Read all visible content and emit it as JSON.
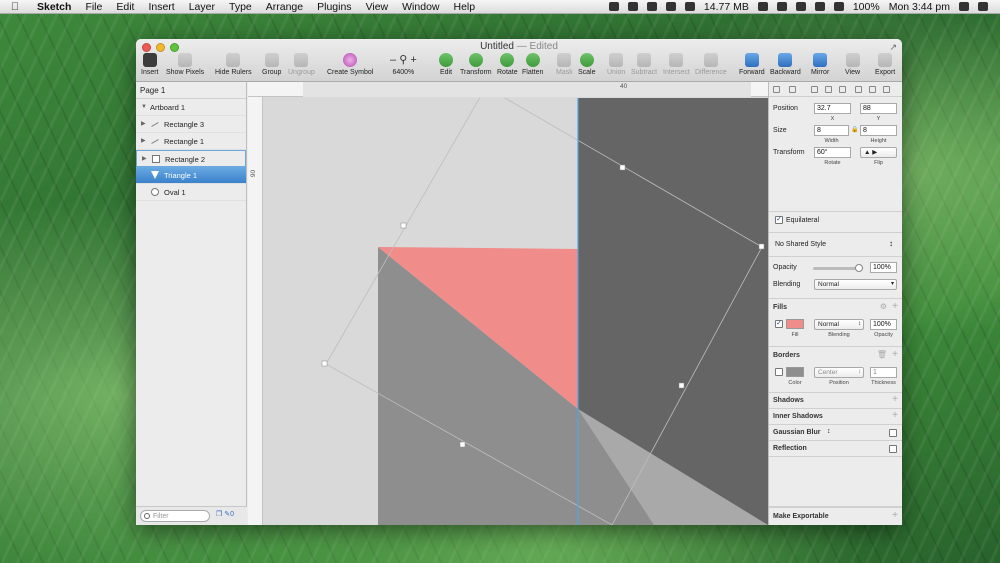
{
  "menubar": {
    "app": "Sketch",
    "items": [
      "File",
      "Edit",
      "Insert",
      "Layer",
      "Type",
      "Arrange",
      "Plugins",
      "View",
      "Window",
      "Help"
    ],
    "memory": "14.77 MB",
    "battery": "100%",
    "clock": "Mon 3:44 pm"
  },
  "window": {
    "title": "Untitled",
    "edited": "— Edited"
  },
  "toolbar": {
    "insert": "Insert",
    "show_pixels": "Show Pixels",
    "hide_rulers": "Hide Rulers",
    "group": "Group",
    "ungroup": "Ungroup",
    "create_symbol": "Create Symbol",
    "zoom": "6400%",
    "edit": "Edit",
    "transform": "Transform",
    "rotate": "Rotate",
    "flatten": "Flatten",
    "mask": "Mask",
    "scale": "Scale",
    "union": "Union",
    "subtract": "Subtract",
    "intersect": "Intersect",
    "difference": "Difference",
    "forward": "Forward",
    "backward": "Backward",
    "mirror": "Mirror",
    "view": "View",
    "export": "Export"
  },
  "layers": {
    "page": "Page 1",
    "artboard": "Artboard 1",
    "items": [
      {
        "name": "Rectangle 3",
        "icon": "line-icon"
      },
      {
        "name": "Rectangle 1",
        "icon": "line-icon"
      },
      {
        "name": "Rectangle 2",
        "icon": "rectangle-icon"
      },
      {
        "name": "Triangle 1",
        "icon": "triangle-icon"
      },
      {
        "name": "Oval 1",
        "icon": "oval-icon"
      }
    ],
    "filter_placeholder": "Filter",
    "filter_count": "0"
  },
  "rulers": {
    "h_label": "40",
    "v_label": "90"
  },
  "inspector": {
    "position_label": "Position",
    "x": "32.7",
    "y": "88",
    "x_label": "X",
    "y_label": "Y",
    "size_label": "Size",
    "width": "8",
    "height": "8",
    "width_label": "Width",
    "height_label": "Height",
    "transform_label": "Transform",
    "rotate": "60°",
    "rotate_label": "Rotate",
    "flip_label": "Flip",
    "equilateral": "Equilateral",
    "shared_style": "No Shared Style",
    "opacity_label": "Opacity",
    "opacity": "100%",
    "opacity_fraction": 1.0,
    "blending_label": "Blending",
    "blending": "Normal",
    "fills_title": "Fills",
    "fill_color": "#f08c8a",
    "fill_blending": "Normal",
    "fill_opacity": "100%",
    "fill_label": "Fill",
    "fill_blending_label": "Blending",
    "fill_opacity_label": "Opacity",
    "borders_title": "Borders",
    "border_color": "#8e8e8e",
    "border_position": "Center",
    "border_thickness": "1",
    "color_label": "Color",
    "position_sub_label": "Position",
    "thickness_label": "Thickness",
    "shadows_title": "Shadows",
    "inner_shadows_title": "Inner Shadows",
    "gaussian_blur": "Gaussian Blur",
    "reflection_title": "Reflection",
    "make_exportable": "Make Exportable"
  },
  "canvas_colors": {
    "background": "#d9d9d9",
    "dark_rect": "#656565",
    "mid_rect": "#8e8e8e",
    "light_rect": "#a9a9a9",
    "triangle": "#f08c8a",
    "guide": "#4aa8e8"
  }
}
